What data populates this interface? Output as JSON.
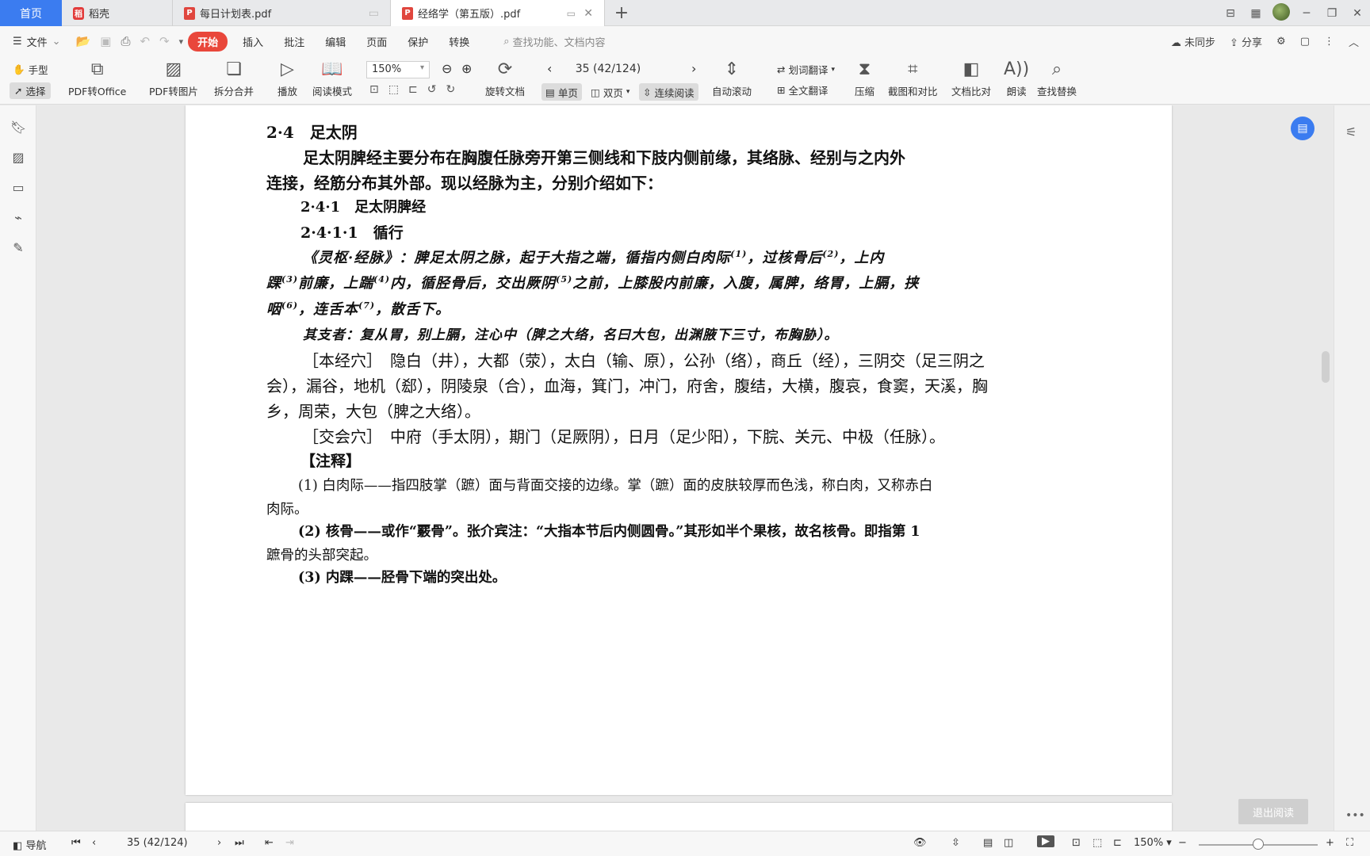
{
  "tabs": {
    "home": "首页",
    "docer": "稻壳",
    "doc1": "每日计划表.pdf",
    "doc2": "经络学（第五版）.pdf",
    "add": "+"
  },
  "menu": {
    "file": "文件",
    "start": "开始",
    "insert": "插入",
    "annotate": "批注",
    "edit": "编辑",
    "page": "页面",
    "protect": "保护",
    "convert": "转换",
    "search_placeholder": "查找功能、文档内容",
    "sync": "未同步",
    "share": "分享"
  },
  "ribbon": {
    "hand": "手型",
    "select": "选择",
    "pdf_to_office": "PDF转Office",
    "pdf_to_image": "PDF转图片",
    "split_merge": "拆分合并",
    "play": "播放",
    "read_mode": "阅读模式",
    "zoom": "150%",
    "rotate": "旋转文档",
    "page_indicator": "35 (42/124)",
    "single": "单页",
    "double": "双页",
    "continuous": "连续阅读",
    "auto_scroll": "自动滚动",
    "word_translate": "划词翻译",
    "full_translate": "全文翻译",
    "compress": "压缩",
    "screenshot_compare": "截图和对比",
    "doc_compare": "文档比对",
    "read_aloud": "朗读",
    "find_replace": "查找替换"
  },
  "document": {
    "heading": "2·4　足太阴",
    "intro_line1": "足太阴脾经主要分布在胸腹任脉旁开第三侧线和下肢内侧前缘，其络脉、经别与之内外",
    "intro_line2": "连接，经筋分布其外部。现以经脉为主，分别介绍如下：",
    "sub1": "2·4·1　足太阴脾经",
    "sub2": "2·4·1·1　循行",
    "quote_line1_a": "《灵枢·经脉》：脾足太阴之脉，起于大指之端，循指内侧白肉际",
    "fn1": "(1)",
    "quote_line1_b": "，过核骨后",
    "fn2": "(2)",
    "quote_line1_c": "，上内",
    "quote_line2_a": "踝",
    "fn3": "(3)",
    "quote_line2_b": "前廉，上踹",
    "fn4": "(4)",
    "quote_line2_c": "内，循胫骨后，交出厥阴",
    "fn5": "(5)",
    "quote_line2_d": "之前，上膝股内前廉，入腹，属脾，络胃，上膈，挟",
    "quote_line3_a": "咽",
    "fn6": "(6)",
    "quote_line3_b": "，连舌本",
    "fn7": "(7)",
    "quote_line3_c": "，散舌下。",
    "branch": "其支者：复从胃，别上膈，注心中（脾之大络，名曰大包，出渊腋下三寸，布胸胁）。",
    "points_line1": "［本经穴］　隐白（井），大都（荥），太白（输、原），公孙（络），商丘（经），三阴交（足三阴之",
    "points_line2": "会），漏谷，地机（郄），阴陵泉（合），血海，箕门，冲门，府舍，腹结，大横，腹哀，食窦，天溪，胸",
    "points_line3": "乡，周荣，大包（脾之大络）。",
    "cross": "［交会穴］　中府（手太阴），期门（足厥阴），日月（足少阳），下脘、关元、中极（任脉）。",
    "notes_title": "【注释】",
    "note1_line1": "(1) 白肉际——指四肢掌（蹠）面与背面交接的边缘。掌（蹠）面的皮肤较厚而色浅，称白肉，又称赤白",
    "note1_line2": "肉际。",
    "note2_line1": "(2) 核骨——或作“覈骨”。张介宾注：“大指本节后内侧圆骨。”其形如半个果核，故名核骨。即指第 1",
    "note2_line2": "蹠骨的头部突起。",
    "note3": "(3) 内踝——胫骨下端的突出处。"
  },
  "status": {
    "nav": "导航",
    "page": "35 (42/124)",
    "zoom": "150%"
  },
  "floating": {
    "gray_button": "退出阅读"
  },
  "colors": {
    "accent": "#3b7cf0",
    "start_button": "#e9473b"
  }
}
